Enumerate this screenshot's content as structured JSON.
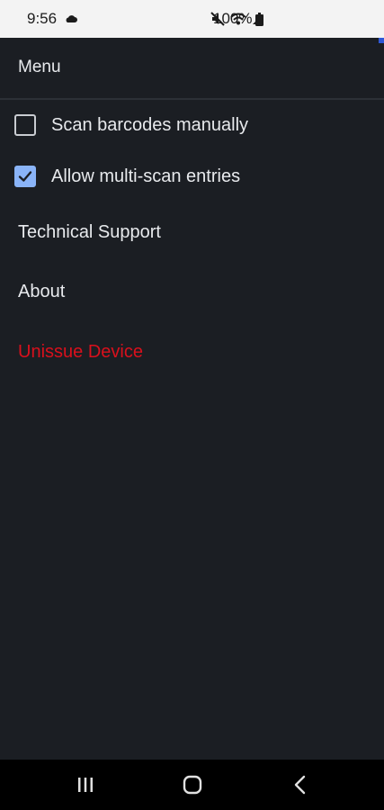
{
  "status_bar": {
    "time": "9:56",
    "battery": "100%",
    "icons": [
      "cloud-icon",
      "mute-icon",
      "wifi-icon",
      "signal-icon",
      "battery-icon"
    ]
  },
  "menu": {
    "title": "Menu",
    "checkboxes": [
      {
        "label": "Scan barcodes manually",
        "checked": false
      },
      {
        "label": "Allow multi-scan entries",
        "checked": true
      }
    ],
    "items": [
      {
        "label": "Technical Support"
      },
      {
        "label": "About"
      },
      {
        "label": "Unissue Device",
        "color": "#d9101c"
      }
    ]
  },
  "nav_bar": {
    "buttons": [
      "recent-apps-icon",
      "home-icon",
      "back-icon"
    ]
  },
  "colors": {
    "background": "#1b1e23",
    "accent": "#8ab4f8",
    "danger": "#d9101c"
  }
}
